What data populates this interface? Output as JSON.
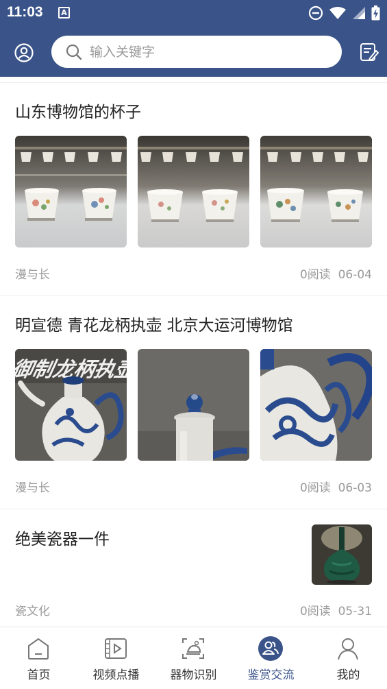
{
  "status_bar": {
    "time": "11:03",
    "notification_letter": "A"
  },
  "header": {
    "search_placeholder": "输入关键字"
  },
  "posts": [
    {
      "title": "山东博物馆的杯子",
      "author": "漫与长",
      "reads": "0阅读",
      "date": "06-04"
    },
    {
      "title": "明宣德 青花龙柄执壶 北京大运河博物馆",
      "author": "漫与长",
      "reads": "0阅读",
      "date": "06-03",
      "image_overlay_text": "御制龙柄执壶"
    },
    {
      "title": "绝美瓷器一件",
      "author": "瓷文化",
      "reads": "0阅读",
      "date": "05-31"
    }
  ],
  "tabs": [
    {
      "label": "首页",
      "icon": "home-icon",
      "active": false
    },
    {
      "label": "视频点播",
      "icon": "video-play-icon",
      "active": false
    },
    {
      "label": "器物识别",
      "icon": "scan-recognize-icon",
      "active": false
    },
    {
      "label": "鉴赏交流",
      "icon": "community-icon",
      "active": true
    },
    {
      "label": "我的",
      "icon": "profile-icon",
      "active": false
    }
  ],
  "colors": {
    "brand": "#3a5489",
    "muted_text": "#9a9a9a",
    "title_text": "#222222"
  }
}
